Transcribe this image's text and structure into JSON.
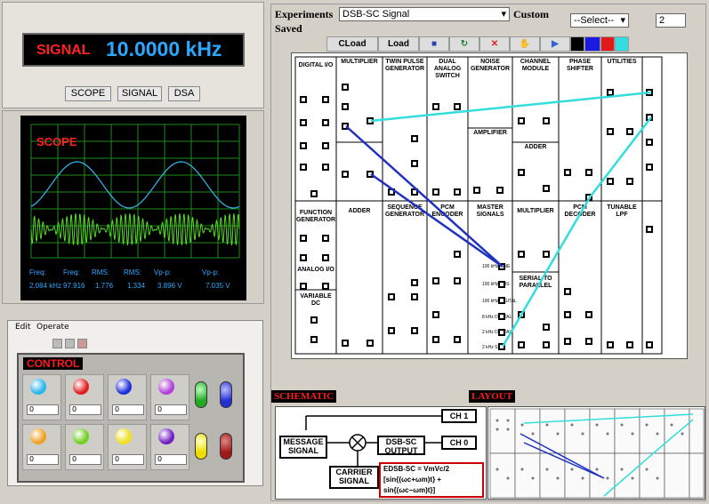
{
  "signal": {
    "label": "SIGNAL",
    "value": "10.0000 kHz"
  },
  "mode_buttons": [
    "SCOPE",
    "SIGNAL",
    "DSA"
  ],
  "scope": {
    "label": "SCOPE",
    "measurements": [
      {
        "label": "Freq:",
        "value": "2.084 kHz"
      },
      {
        "label": "Freq:",
        "value": "97.916"
      },
      {
        "label": "RMS:",
        "value": "1.776"
      },
      {
        "label": "RMS:",
        "value": "1.334"
      },
      {
        "label": "Vp-p:",
        "value": "3.896 V"
      },
      {
        "label": "Vp-p:",
        "value": "7.035 V"
      }
    ]
  },
  "control": {
    "menu": [
      "Edit",
      "Operate"
    ],
    "title": "CONTROL",
    "knobs": [
      {
        "color": "#29b6e8",
        "value": "0"
      },
      {
        "color": "#e02020",
        "value": "0"
      },
      {
        "color": "#2030d8",
        "value": "0"
      },
      {
        "color": "#b040d8",
        "value": "0"
      },
      {
        "color": "#f0a020",
        "value": "0"
      },
      {
        "color": "#70d020",
        "value": "0"
      },
      {
        "color": "#f0e020",
        "value": "0"
      },
      {
        "color": "#7020c0",
        "value": "0"
      }
    ],
    "leds": [
      "#22aa22",
      "#2230d0",
      "#eedd00",
      "#a01818"
    ]
  },
  "experiment": {
    "experiments_label": "Experiments",
    "selected": "DSB-SC Signal",
    "custom_label": "Custom",
    "custom_select": "--Select--",
    "count": "2",
    "saved_label": "Saved",
    "toolbar": {
      "cload": "CLoad",
      "load": "Load"
    }
  },
  "modules": [
    {
      "title": "DIGITAL I/O"
    },
    {
      "title": "MULTIPLIER"
    },
    {
      "title": "TWIN PULSE GENERATOR"
    },
    {
      "title": "DUAL ANALOG SWITCH"
    },
    {
      "title": "NOISE GENERATOR"
    },
    {
      "title": "CHANNEL MODULE"
    },
    {
      "title": "PHASE SHIFTER"
    },
    {
      "title": "UTILITIES"
    },
    {
      "title": "FUNCTION GENERATOR"
    },
    {
      "title": "ADDER"
    },
    {
      "title": "SEQUENCE GENERATOR"
    },
    {
      "title": "PCM ENCODER"
    },
    {
      "title": "MASTER SIGNALS"
    },
    {
      "title": "MULTIPLIER"
    },
    {
      "title": "PCM DECODER"
    },
    {
      "title": "TUNABLE LPF"
    },
    {
      "title": "AMPLIFIER"
    },
    {
      "title": "ADDER"
    },
    {
      "title": "ANALOG I/O"
    },
    {
      "title": "VARIABLE DC"
    },
    {
      "title": "SERIAL TO PARALLEL"
    }
  ],
  "master_signals": [
    "100 kHz SINE",
    "100 kHz COS",
    "100 kHz DIGITAL",
    "8 kHz DIGITAL",
    "2 kHz DIGITAL",
    "2 kHz SINE"
  ],
  "schematic": {
    "label": "SCHEMATIC",
    "message": "MESSAGE SIGNAL",
    "carrier": "CARRIER SIGNAL",
    "output": "DSB-SC OUTPUT",
    "ch1": "CH 1",
    "ch0": "CH 0",
    "formula1": "EDSB-SC = VmVc/2",
    "formula2": "[sin{(ωc+ωm)t} +",
    "formula3": "sin{(ωc−ωm)t}]"
  },
  "layout_label": "LAYOUT"
}
